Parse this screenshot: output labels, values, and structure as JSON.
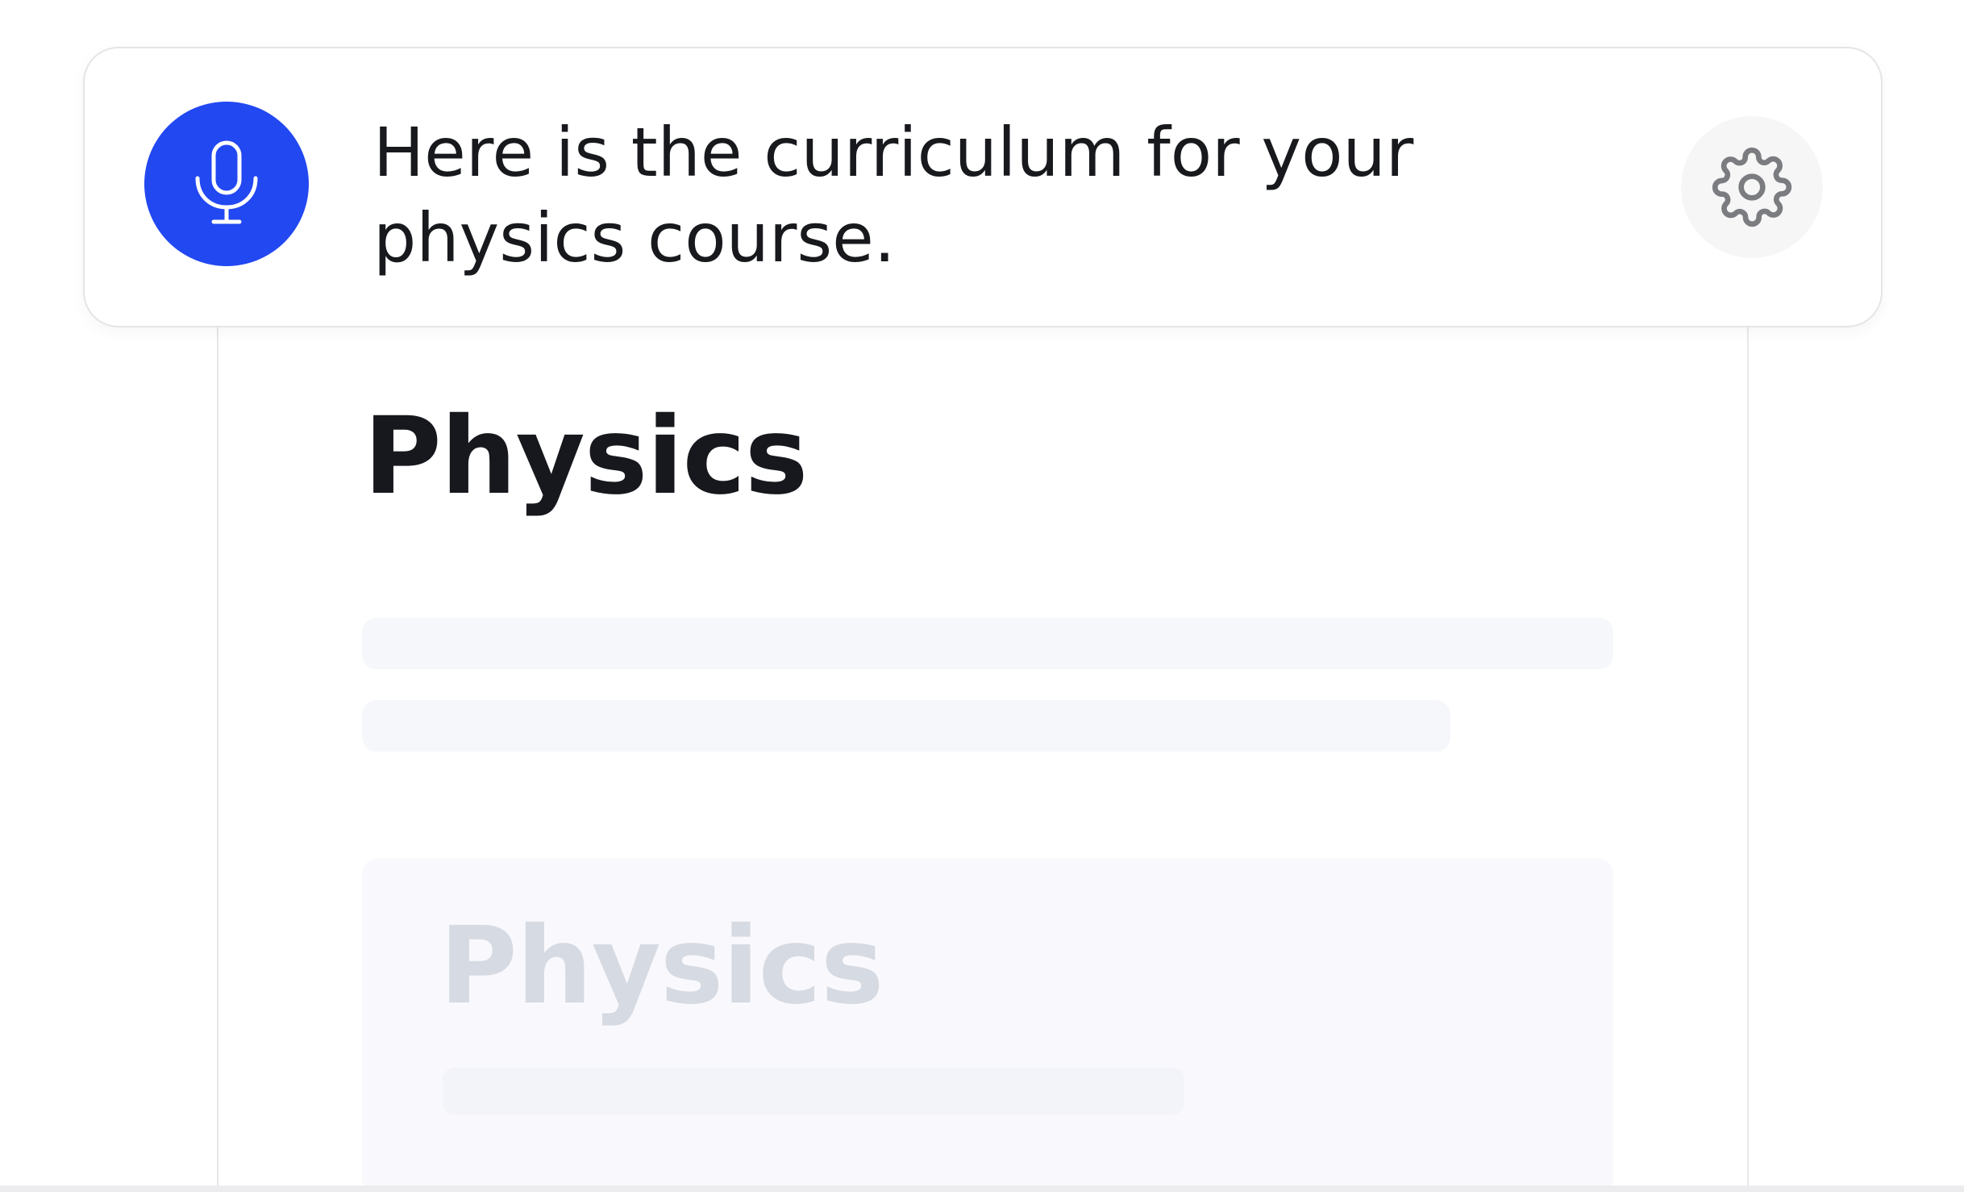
{
  "voice_bar": {
    "message": "Here is the curriculum for your physics course.",
    "mic_icon": "microphone-icon",
    "settings_icon": "gear-icon",
    "accent_color": "#2248f2"
  },
  "document": {
    "title": "Physics",
    "preview": {
      "title": "Physics"
    }
  }
}
